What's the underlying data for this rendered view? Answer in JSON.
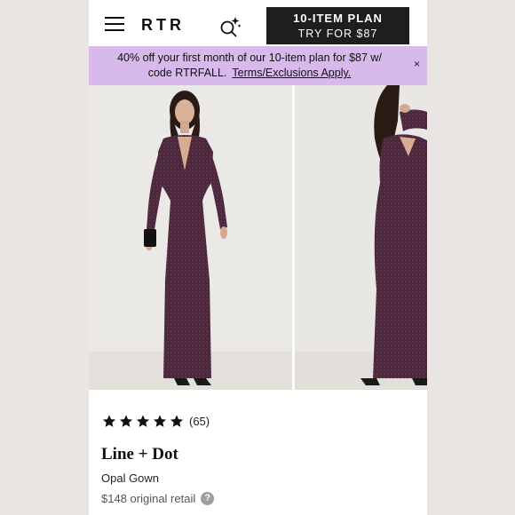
{
  "header": {
    "logo": "RTR",
    "cta_line1": "10-ITEM PLAN",
    "cta_line2": "TRY FOR $87"
  },
  "promo": {
    "text": "40% off your first month of our 10-item plan for $87 w/ code RTRFALL.",
    "link": "Terms/Exclusions Apply.",
    "close": "×"
  },
  "product": {
    "rating": 5,
    "review_count": "(65)",
    "brand": "Line + Dot",
    "name": "Opal Gown",
    "retail": "$148 original retail",
    "help": "?"
  },
  "colors": {
    "accent_promo": "#d8b9ec",
    "cta": "#1e1e1e",
    "dress": "#4a2a3f"
  },
  "icons": [
    "menu-icon",
    "search-sparkle-icon",
    "close-icon",
    "star-icon",
    "help-icon"
  ]
}
